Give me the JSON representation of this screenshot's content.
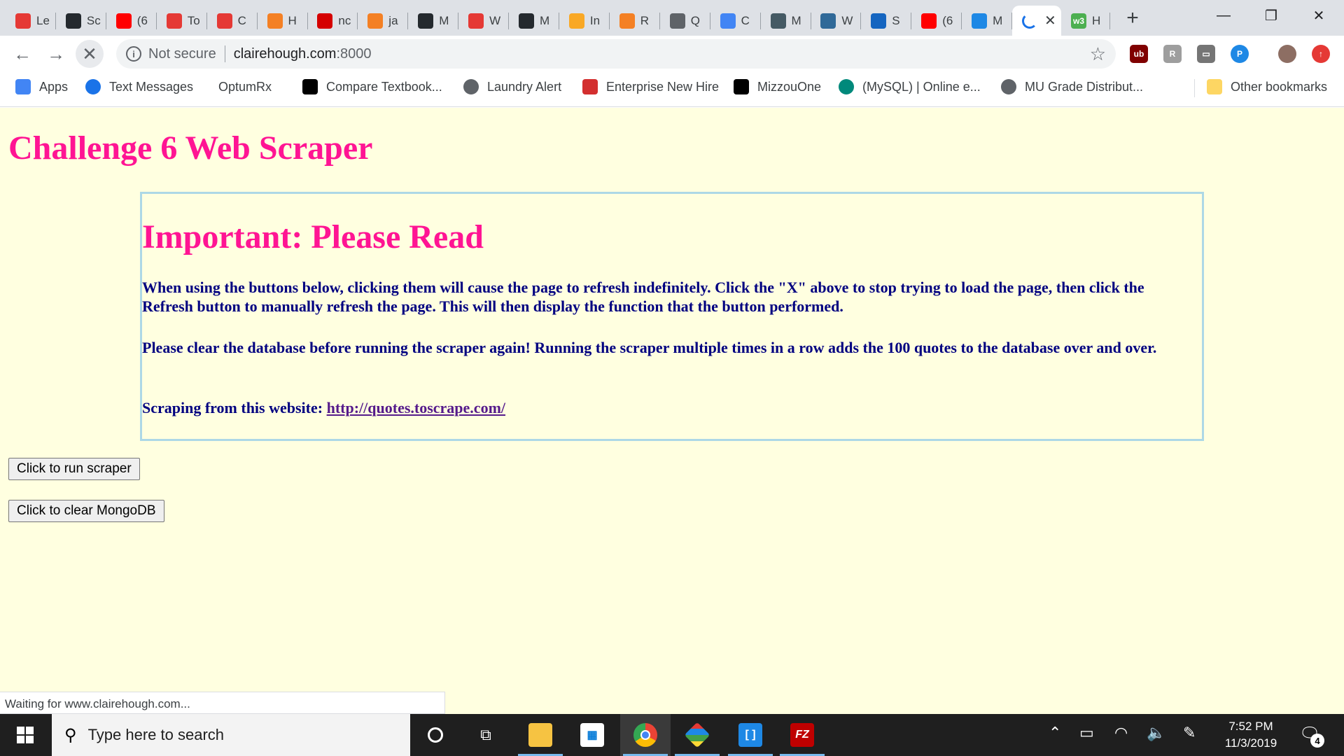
{
  "browser": {
    "tabs": [
      {
        "title": "Le",
        "icon": "asterisk-red-icon",
        "color": "#e53935"
      },
      {
        "title": "Sc",
        "icon": "github-icon",
        "color": "#24292e"
      },
      {
        "title": "(6",
        "icon": "youtube-icon",
        "color": "#ff0000"
      },
      {
        "title": "To",
        "icon": "asterisk-red-icon",
        "color": "#e53935"
      },
      {
        "title": "C",
        "icon": "asterisk-red-icon",
        "color": "#e53935"
      },
      {
        "title": "H",
        "icon": "stackoverflow-icon",
        "color": "#f48024"
      },
      {
        "title": "nc",
        "icon": "n-red-icon",
        "color": "#d50000"
      },
      {
        "title": "ja",
        "icon": "stackoverflow-icon",
        "color": "#f48024"
      },
      {
        "title": "M",
        "icon": "github-icon",
        "color": "#24292e"
      },
      {
        "title": "W",
        "icon": "asterisk-red-icon",
        "color": "#e53935"
      },
      {
        "title": "M",
        "icon": "github-icon",
        "color": "#24292e"
      },
      {
        "title": "In",
        "icon": "box-yellow-icon",
        "color": "#f9a825"
      },
      {
        "title": "R",
        "icon": "stackoverflow-icon",
        "color": "#f48024"
      },
      {
        "title": "Q",
        "icon": "globe-icon",
        "color": "#5f6368"
      },
      {
        "title": "C",
        "icon": "docs-icon",
        "color": "#4285f4"
      },
      {
        "title": "M",
        "icon": "diamond-icon",
        "color": "#455a64"
      },
      {
        "title": "W",
        "icon": "python-icon",
        "color": "#306998"
      },
      {
        "title": "S",
        "icon": "siv-icon",
        "color": "#1565c0"
      },
      {
        "title": "(6",
        "icon": "youtube-icon",
        "color": "#ff0000"
      },
      {
        "title": "M",
        "icon": "blue-circle-icon",
        "color": "#1e88e5"
      }
    ],
    "active_tab": {
      "title": "",
      "icon": "loading-spinner-icon"
    },
    "last_tab": {
      "title": "H",
      "icon": "w3-icon",
      "color": "#4caf50"
    },
    "url_security": "Not secure",
    "url_host": "clairehough.com",
    "url_port": ":8000",
    "bookmarks": [
      {
        "label": "Apps",
        "icon": "apps-grid-icon",
        "color": "#4285f4"
      },
      {
        "label": "Text Messages",
        "icon": "messages-icon",
        "color": "#1a73e8"
      },
      {
        "label": "OptumRx",
        "icon": "",
        "color": ""
      },
      {
        "label": "Compare Textbook...",
        "icon": "mizzou-icon",
        "color": "#000000"
      },
      {
        "label": "Laundry Alert",
        "icon": "globe-icon",
        "color": "#5f6368"
      },
      {
        "label": "Enterprise New Hire",
        "icon": "info-i-icon",
        "color": "#d32f2f"
      },
      {
        "label": "MizzouOne",
        "icon": "mizzou-icon",
        "color": "#000000"
      },
      {
        "label": "(MySQL) | Online e...",
        "icon": "mysql-c-icon",
        "color": "#00897b"
      },
      {
        "label": "MU Grade Distribut...",
        "icon": "globe-icon",
        "color": "#5f6368"
      }
    ],
    "other_bookmarks": "Other bookmarks",
    "status_text": "Waiting for www.clairehough.com..."
  },
  "page": {
    "title": "Challenge 6 Web Scraper",
    "notice_title": "Important: Please Read",
    "paragraph1": "When using the buttons below, clicking them will cause the page to refresh indefinitely. Click the \"X\" above to stop trying to load the page, then click the Refresh button to manually refresh the page. This will then display the function that the button performed.",
    "paragraph2": "Please clear the database before running the scraper again! Running the scraper multiple times in a row adds the 100 quotes to the database over and over.",
    "source_label": "Scraping from this website: ",
    "source_url": "http://quotes.toscrape.com/",
    "run_button": "Click to run scraper",
    "clear_button": "Click to clear MongoDB",
    "colors": {
      "background": "#ffffe0",
      "heading": "#ff1493",
      "text": "#000080",
      "border": "#add8e6",
      "link": "#551a8b"
    }
  },
  "taskbar": {
    "search_placeholder": "Type here to search",
    "time": "7:52 PM",
    "date": "11/3/2019",
    "notification_count": "4"
  }
}
